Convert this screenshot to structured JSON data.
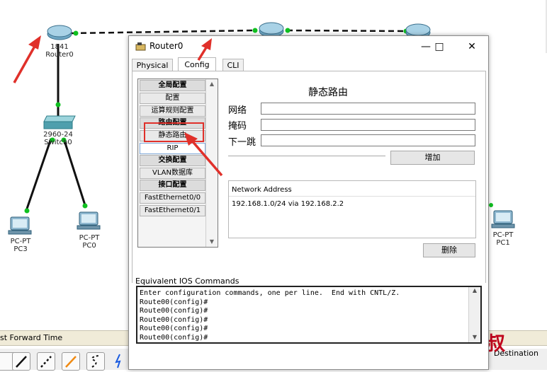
{
  "topology": {
    "devices": [
      {
        "id": "router0",
        "label_lines": [
          "1841",
          "Router0"
        ]
      },
      {
        "id": "switch0",
        "label_lines": [
          "2960-24",
          "Switch0"
        ]
      },
      {
        "id": "pc3",
        "label_lines": [
          "PC-PT",
          "PC3"
        ]
      },
      {
        "id": "pc0",
        "label_lines": [
          "PC-PT",
          "PC0"
        ]
      },
      {
        "id": "pc1",
        "label_lines": [
          "PC-PT",
          "PC1"
        ]
      }
    ],
    "bottom_bar_text": "st Forward Time",
    "destination_label": "Destination",
    "watermark": "自眉大叔"
  },
  "dialog": {
    "title": "Router0",
    "tabs": [
      {
        "label": "Physical",
        "active": false
      },
      {
        "label": "Config",
        "active": true
      },
      {
        "label": "CLI",
        "active": false
      }
    ],
    "left_menu": [
      {
        "label": "全局配置",
        "type": "header"
      },
      {
        "label": "配置",
        "type": "item"
      },
      {
        "label": "运算规则配置",
        "type": "item"
      },
      {
        "label": "路由配置",
        "type": "header"
      },
      {
        "label": "静态路由",
        "type": "item",
        "highlighted": true
      },
      {
        "label": "RIP",
        "type": "item",
        "selected": true
      },
      {
        "label": "交换配置",
        "type": "header"
      },
      {
        "label": "VLAN数据库",
        "type": "item"
      },
      {
        "label": "接口配置",
        "type": "header"
      },
      {
        "label": "FastEthernet0/0",
        "type": "item"
      },
      {
        "label": "FastEthernet0/1",
        "type": "item"
      }
    ],
    "static_route": {
      "title": "静态路由",
      "network_label": "网络",
      "network_value": "",
      "mask_label": "掩码",
      "mask_value": "",
      "next_hop_label": "下一跳",
      "next_hop_value": "",
      "add_button": "增加",
      "table_header": "Network Address",
      "routes": [
        "192.168.1.0/24 via 192.168.2.2"
      ],
      "delete_button": "删除"
    },
    "ios": {
      "label": "Equivalent IOS Commands",
      "lines": [
        "Enter configuration commands, one per line.  End with CNTL/Z.",
        "Route00(config)#",
        "Route00(config)#",
        "Route00(config)#",
        "Route00(config)#",
        "Route00(config)#"
      ]
    }
  },
  "colors": {
    "annotation_red": "#e0302a",
    "link_green": "#10c020",
    "cable_black": "#111111",
    "watermark_red": "#c0061d"
  }
}
